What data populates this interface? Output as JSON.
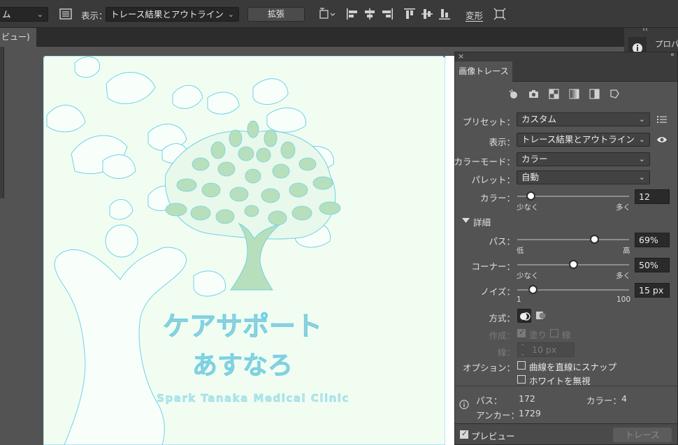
{
  "control_bar": {
    "first_dropdown_tail": "ム",
    "view_label": "表示：",
    "view_value": "トレース結果とアウトライン",
    "expand_button": "拡張",
    "transform_label": "変形"
  },
  "document_tab": {
    "label": "ビュー)"
  },
  "right_dock": {
    "label": "プロパ",
    "collapse": "‹‹"
  },
  "artwork": {
    "brand_line1": "ケアサポート",
    "brand_line2": "あすなろ",
    "brand_line3": "Spark Tanaka Medical Clinic",
    "colors": {
      "background": "#f2fdf2",
      "outline": "#6fd2e8",
      "leaf_green": "#b8dfbb",
      "text_gray": "#b8c8c6"
    }
  },
  "trace_panel": {
    "tab_title": "画像トレース",
    "preset_icons": [
      "auto-color-icon",
      "high-fidelity-photo-icon",
      "low-fidelity-photo-icon",
      "grayscale-icon",
      "black-and-white-icon",
      "outline-icon"
    ],
    "preset": {
      "label": "プリセット：",
      "value": "カスタム"
    },
    "view": {
      "label": "表示：",
      "value": "トレース結果とアウトライン"
    },
    "color_mode": {
      "label": "カラーモード：",
      "value": "カラー"
    },
    "palette": {
      "label": "パレット：",
      "value": "自動"
    },
    "colors": {
      "label": "カラー：",
      "value": "12",
      "min_label": "少なく",
      "max_label": "多く",
      "level": 0.12
    },
    "advanced": {
      "label": "詳細"
    },
    "paths": {
      "label": "パス：",
      "value": "69%",
      "min_label": "低",
      "max_label": "高",
      "level": 0.69
    },
    "corners": {
      "label": "コーナー：",
      "value": "50%",
      "min_label": "少なく",
      "max_label": "多く",
      "level": 0.5
    },
    "noise": {
      "label": "ノイズ：",
      "value": "15 px",
      "min_label": "1",
      "max_label": "100",
      "level": 0.14
    },
    "method": {
      "label": "方式："
    },
    "create": {
      "label": "作成：",
      "fill_label": "塗り",
      "stroke_label": "線",
      "fill_checked": true,
      "stroke_checked": false
    },
    "stroke": {
      "label": "線：",
      "value": "10 px"
    },
    "options": {
      "label": "オプション：",
      "snap_label": "曲線を直線にスナップ",
      "ignore_white_label": "ホワイトを無視",
      "snap_checked": false,
      "ignore_white_checked": false
    },
    "info": {
      "paths_label": "パス：",
      "paths_value": "172",
      "colors_label": "カラー：",
      "colors_value": "4",
      "anchors_label": "アンカー：",
      "anchors_value": "1729"
    },
    "preview_label": "プレビュー",
    "preview_checked": true,
    "trace_button": "トレース"
  }
}
